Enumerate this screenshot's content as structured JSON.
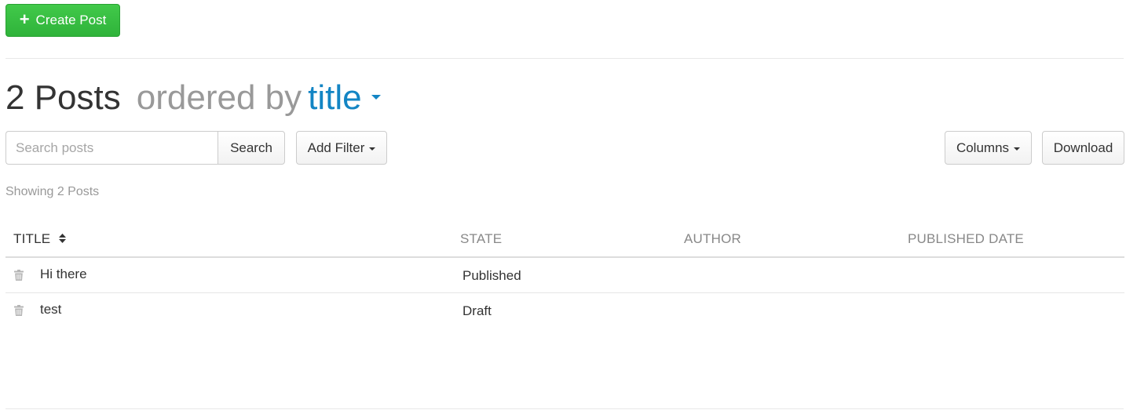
{
  "toolbar": {
    "create_label": "Create Post"
  },
  "heading": {
    "count_label": "2 Posts",
    "ordered_label": "ordered by",
    "sort_field": "title"
  },
  "search": {
    "placeholder": "Search posts",
    "value": "",
    "button_label": "Search"
  },
  "filter_label": "Add Filter",
  "columns_label": "Columns",
  "download_label": "Download",
  "showing_label": "Showing 2 Posts",
  "table": {
    "headers": [
      "TITLE",
      "STATE",
      "AUTHOR",
      "PUBLISHED DATE"
    ],
    "sorted_column": "TITLE",
    "rows": [
      {
        "title": "Hi there",
        "state": "Published",
        "author": "",
        "published_date": ""
      },
      {
        "title": "test",
        "state": "Draft",
        "author": "",
        "published_date": ""
      }
    ]
  },
  "colors": {
    "create_button": "#2fb33a",
    "link_accent": "#1385c4",
    "muted_text": "#999999"
  },
  "icons": {
    "create": "plus-icon",
    "sort": "sort-icon",
    "delete": "trash-icon",
    "dropdown": "caret-down-icon"
  }
}
